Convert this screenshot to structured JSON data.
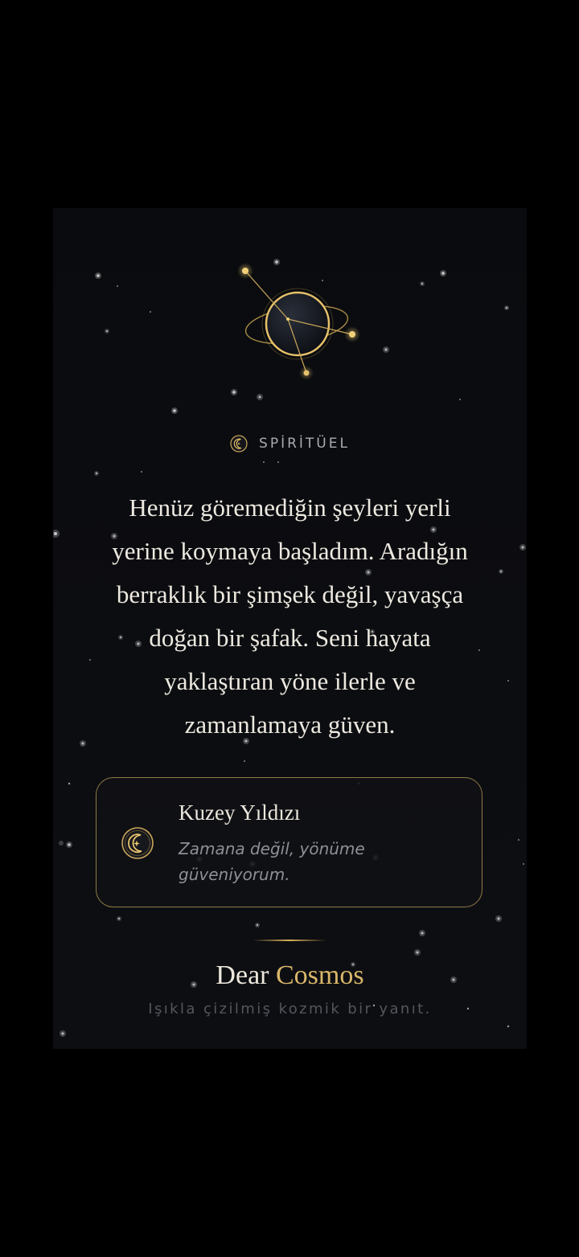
{
  "category": {
    "label": "SPİRİTÜEL",
    "icon": "moon-star-icon"
  },
  "message": {
    "lines": [
      "Henüz göremediğin şeyleri yerli",
      "yerine koymaya başladım. Aradığın",
      "berraklık bir şimşek değil, yavaşça",
      "doğan bir şafak. Seni hayata",
      "yaklaştıran yöne ilerle ve",
      "zamanlamaya güven."
    ]
  },
  "intention": {
    "icon": "moon-star-icon",
    "title": "Kuzey Yıldızı",
    "text": "Zamana değil, yönüme güveniyorum."
  },
  "brand": {
    "name_part1": "Dear",
    "name_part2": "Cosmos",
    "tagline": "Işıkla çizilmiş kozmik bir yanıt."
  },
  "colors": {
    "background": "#0b0c10",
    "gold": "#d9b76a",
    "text": "#ede9e0",
    "muted": "#8d8f96"
  }
}
